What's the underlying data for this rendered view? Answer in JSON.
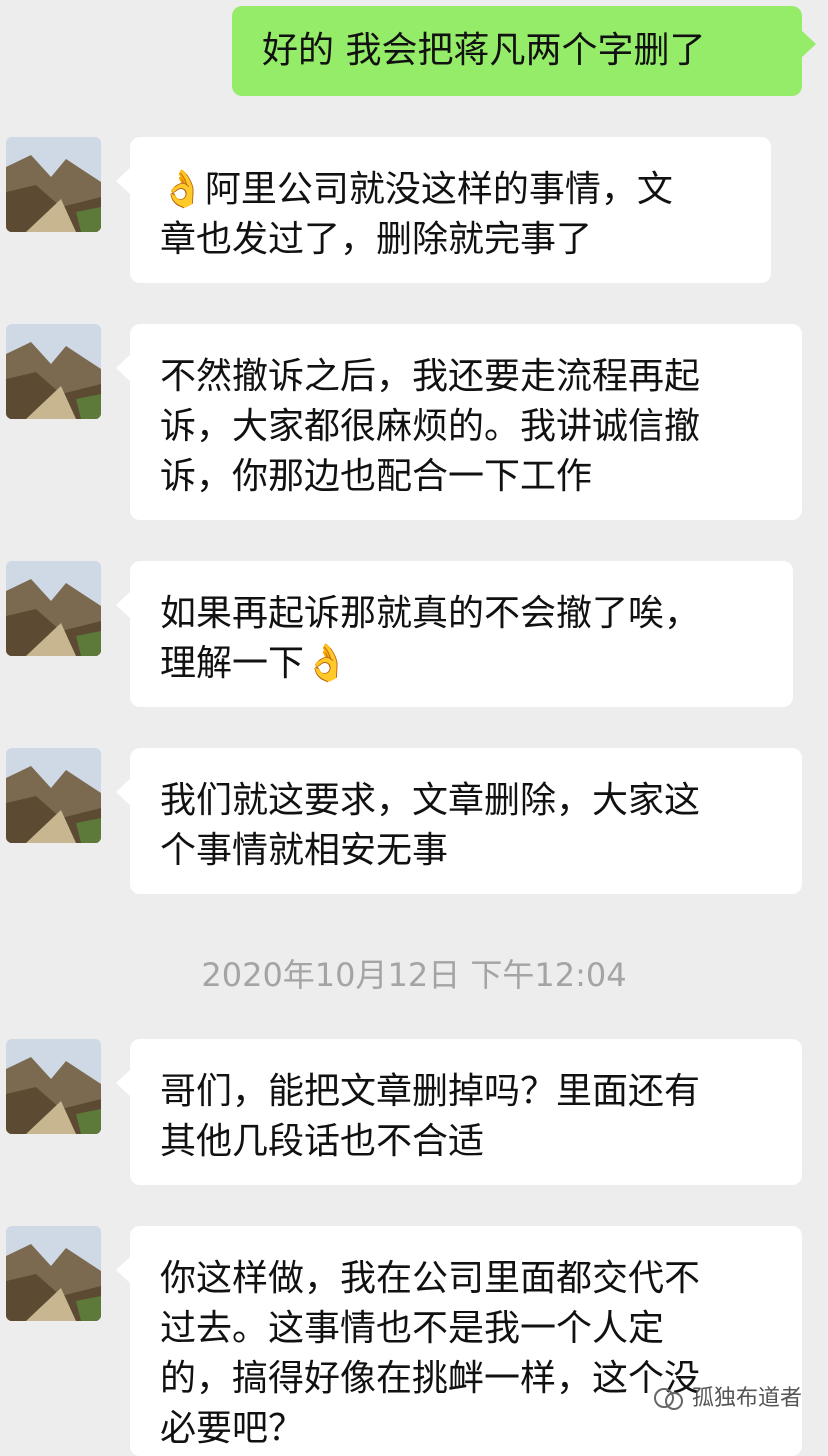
{
  "messages": [
    {
      "side": "right",
      "text": "好的  我会把蒋凡两个字删了"
    },
    {
      "side": "left",
      "text": "👌阿里公司就没这样的事情，文\n章也发过了，删除就完事了"
    },
    {
      "side": "left",
      "text": "不然撤诉之后，我还要走流程再起\n诉，大家都很麻烦的。我讲诚信撤\n诉，你那边也配合一下工作"
    },
    {
      "side": "left",
      "text": "如果再起诉那就真的不会撤了唉，\n理解一下👌"
    },
    {
      "side": "left",
      "text": "我们就这要求，文章删除，大家这\n个事情就相安无事"
    },
    {
      "side": "left",
      "text": "哥们，能把文章删掉吗？里面还有\n其他几段话也不合适"
    },
    {
      "side": "left",
      "text": "你这样做，我在公司里面都交代不\n过去。这事情也不是我一个人定\n的，搞得好像在挑衅一样，这个没\n必要吧？"
    }
  ],
  "timestamp": "2020年10月12日 下午12:04",
  "watermark": "孤独布道者",
  "colors": {
    "background": "#ededed",
    "bubble_self": "#95ec69",
    "bubble_other": "#ffffff",
    "timestamp": "#a4a4a4"
  },
  "icons": {
    "avatar": "mountain-landscape-avatar",
    "watermark": "wechat-channel-icon"
  }
}
